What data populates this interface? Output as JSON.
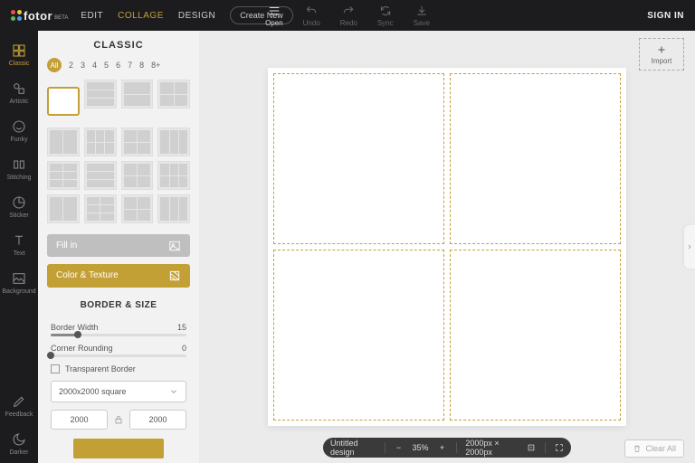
{
  "brand": {
    "name": "fotor",
    "tag": "BETA"
  },
  "nav": {
    "edit": "EDIT",
    "collage": "COLLAGE",
    "design": "DESIGN",
    "create": "Create New"
  },
  "top": {
    "open": "Open",
    "undo": "Undo",
    "redo": "Redo",
    "sync": "Sync",
    "save": "Save"
  },
  "signin": "SIGN IN",
  "rail": {
    "classic": "Classic",
    "artistic": "Artistic",
    "funky": "Funky",
    "stitching": "Stitching",
    "sticker": "Sticker",
    "text": "Text",
    "background": "Background",
    "feedback": "Feedback",
    "darker": "Darker"
  },
  "panel": {
    "title": "CLASSIC",
    "counts": {
      "all": "All",
      "n2": "2",
      "n3": "3",
      "n4": "4",
      "n5": "5",
      "n6": "6",
      "n7": "7",
      "n8": "8",
      "n8p": "8+"
    },
    "fillin": "Fill in",
    "colortex": "Color & Texture",
    "section": "BORDER & SIZE",
    "bw_label": "Border Width",
    "bw_val": "15",
    "cr_label": "Corner Rounding",
    "cr_val": "0",
    "transparent": "Transparent Border",
    "preset": "2000x2000 square",
    "w": "2000",
    "h": "2000"
  },
  "canvas": {
    "import": "Import",
    "clear": "Clear All",
    "title": "Untitled design",
    "zoom": "35%",
    "dims": "2000px × 2000px"
  }
}
